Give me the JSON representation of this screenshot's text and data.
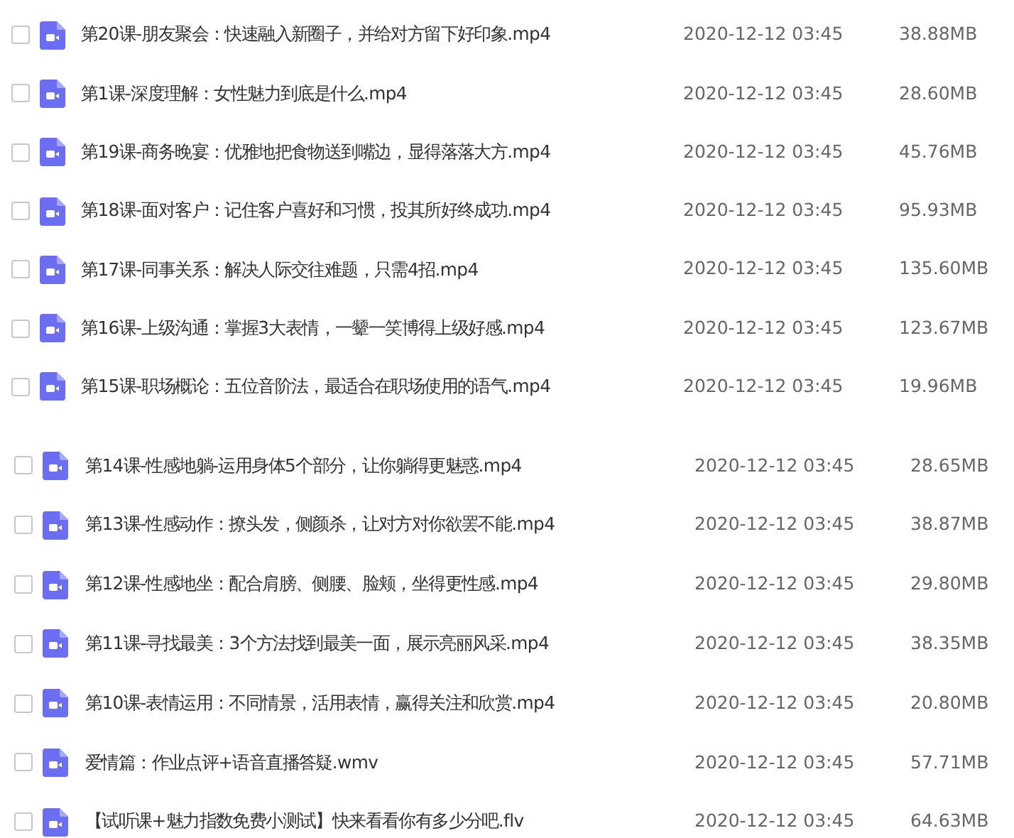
{
  "groups": [
    {
      "files": [
        {
          "name": "第20课-朋友聚会：快速融入新圈子，并给对方留下好印象.mp4",
          "date": "2020-12-12 03:45",
          "size": "38.88MB",
          "checked": false
        },
        {
          "name": "第1课-深度理解：女性魅力到底是什么.mp4",
          "date": "2020-12-12 03:45",
          "size": "28.60MB",
          "checked": false
        },
        {
          "name": "第19课-商务晚宴：优雅地把食物送到嘴边，显得落落大方.mp4",
          "date": "2020-12-12 03:45",
          "size": "45.76MB",
          "checked": false
        },
        {
          "name": "第18课-面对客户：记住客户喜好和习惯，投其所好终成功.mp4",
          "date": "2020-12-12 03:45",
          "size": "95.93MB",
          "checked": false
        },
        {
          "name": "第17课-同事关系：解决人际交往难题，只需4招.mp4",
          "date": "2020-12-12 03:45",
          "size": "135.60MB",
          "checked": false
        },
        {
          "name": "第16课-上级沟通：掌握3大表情，一颦一笑博得上级好感.mp4",
          "date": "2020-12-12 03:45",
          "size": "123.67MB",
          "checked": false
        },
        {
          "name": "第15课-职场概论：五位音阶法，最适合在职场使用的语气.mp4",
          "date": "2020-12-12 03:45",
          "size": "19.96MB",
          "checked": false
        }
      ]
    },
    {
      "files": [
        {
          "name": "第14课-性感地躺-运用身体5个部分，让你躺得更魅惑.mp4",
          "date": "2020-12-12 03:45",
          "size": "28.65MB",
          "checked": false
        },
        {
          "name": "第13课-性感动作：撩头发，侧颜杀，让对方对你欲罢不能.mp4",
          "date": "2020-12-12 03:45",
          "size": "38.87MB",
          "checked": false
        },
        {
          "name": "第12课-性感地坐：配合肩膀、侧腰、脸颊，坐得更性感.mp4",
          "date": "2020-12-12 03:45",
          "size": "29.80MB",
          "checked": false
        },
        {
          "name": "第11课-寻找最美：3个方法找到最美一面，展示亮丽风采.mp4",
          "date": "2020-12-12 03:45",
          "size": "38.35MB",
          "checked": false
        },
        {
          "name": "第10课-表情运用：不同情景，活用表情，赢得关注和欣赏.mp4",
          "date": "2020-12-12 03:45",
          "size": "20.80MB",
          "checked": false
        },
        {
          "name": "爱情篇：作业点评+语音直播答疑.wmv",
          "date": "2020-12-12 03:45",
          "size": "57.71MB",
          "checked": false
        },
        {
          "name": "【试听课+魅力指数免费小测试】快来看看你有多少分吧.flv",
          "date": "2020-12-12 03:45",
          "size": "64.63MB",
          "checked": false
        }
      ]
    }
  ]
}
